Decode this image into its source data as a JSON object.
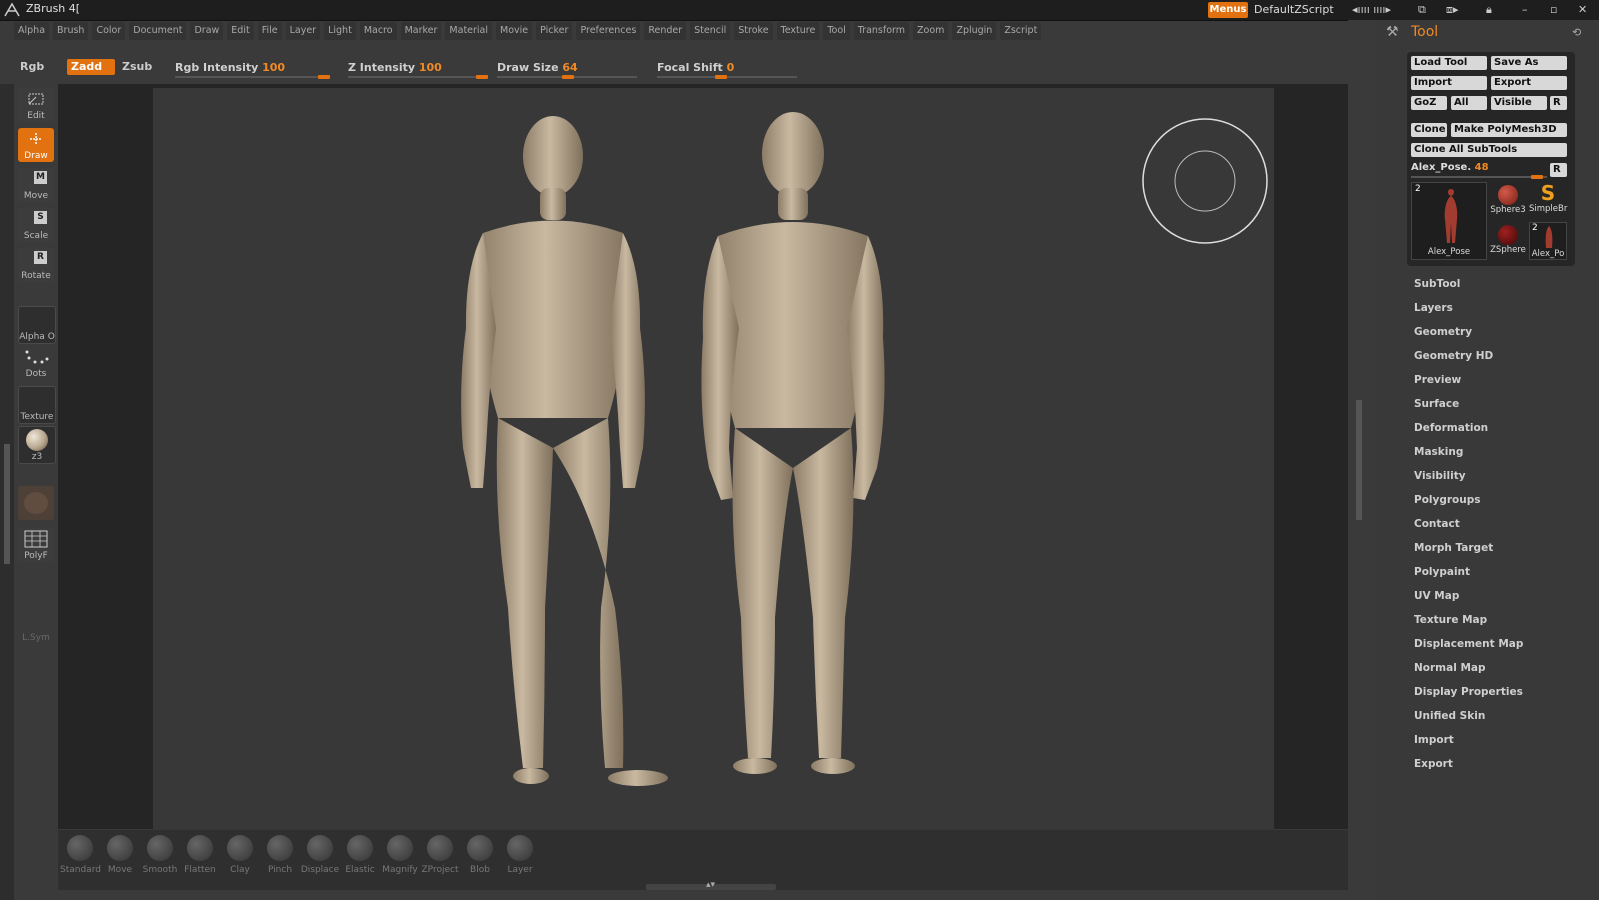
{
  "app": {
    "title": "ZBrush 4[",
    "menus_label": "Menus",
    "script_label": "DefaultZScript"
  },
  "menubar": [
    "Alpha",
    "Brush",
    "Color",
    "Document",
    "Draw",
    "Edit",
    "File",
    "Layer",
    "Light",
    "Macro",
    "Marker",
    "Material",
    "Movie",
    "Picker",
    "Preferences",
    "Render",
    "Stencil",
    "Stroke",
    "Texture",
    "Tool",
    "Transform",
    "Zoom",
    "Zplugin",
    "Zscript"
  ],
  "shelf": {
    "rgb": "Rgb",
    "zadd": "Zadd",
    "zsub": "Zsub",
    "rgb_intensity_label": "Rgb Intensity",
    "rgb_intensity": "100",
    "z_intensity_label": "Z Intensity",
    "z_intensity": "100",
    "draw_size_label": "Draw Size",
    "draw_size": "64",
    "focal_shift_label": "Focal Shift",
    "focal_shift": "0"
  },
  "sliders": {
    "rgb_intensity_level": 1.0,
    "z_intensity_level": 1.0,
    "draw_size_level": 0.55,
    "focal_shift_level": 0.5,
    "subtool_level": 0.97
  },
  "left_tools": {
    "edit": "Edit",
    "draw": "Draw",
    "move": "Move",
    "scale": "Scale",
    "rotate": "Rotate",
    "alpha": "Alpha",
    "alpha_off": "O",
    "dots": "Dots",
    "texture": "Texture",
    "material": "z3",
    "polyf": "PolyF",
    "lsym": "L.Sym",
    "move_key": "M",
    "scale_key": "S",
    "rotate_key": "R"
  },
  "brushes": [
    "Standard",
    "Move",
    "Smooth",
    "Flatten",
    "Clay",
    "Pinch",
    "Displace",
    "Elastic",
    "Magnify",
    "ZProject",
    "Blob",
    "Layer"
  ],
  "tool_panel": {
    "title": "Tool",
    "load_tool": "Load Tool",
    "save_as": "Save As",
    "import": "Import",
    "export": "Export",
    "goz": "GoZ",
    "all": "All",
    "visible": "Visible",
    "r": "R",
    "clone": "Clone",
    "make_polymesh": "Make PolyMesh3D",
    "clone_all": "Clone All SubTools",
    "current_tool": "Alex_Pose.",
    "current_tool_value": "48",
    "thumbs": {
      "main_count": "2",
      "main_label": "Alex_Pose",
      "sphere3": "Sphere3",
      "simplebr": "SimpleBr",
      "zsphere": "ZSphere",
      "alex_po": "Alex_Po",
      "alex_po_count": "2"
    }
  },
  "palette_items": [
    "SubTool",
    "Layers",
    "Geometry",
    "Geometry HD",
    "Preview",
    "Surface",
    "Deformation",
    "Masking",
    "Visibility",
    "Polygroups",
    "Contact",
    "Morph Target",
    "Polypaint",
    "UV Map",
    "Texture Map",
    "Displacement Map",
    "Normal Map",
    "Display Properties",
    "Unified Skin",
    "Import",
    "Export"
  ],
  "colors": {
    "accent": "#e2710f",
    "skin": "#b8a78f",
    "panel": "#393939",
    "canvas": "#383838"
  }
}
